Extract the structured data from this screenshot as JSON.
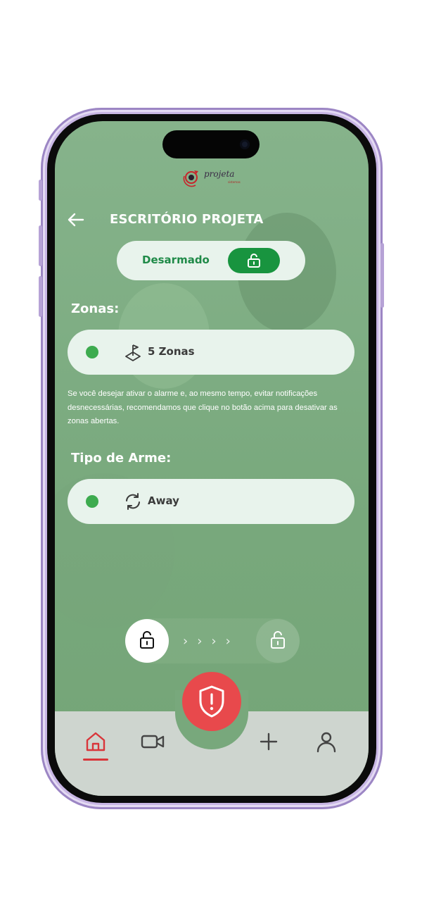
{
  "app": {
    "logo_text": "projeta",
    "logo_sub": "sistemas"
  },
  "header": {
    "title": "ESCRITÓRIO PROJETA",
    "back_icon": "arrow-left-icon"
  },
  "status": {
    "label": "Desarmado",
    "toggle_icon": "unlock-icon",
    "toggle_color": "#18943f"
  },
  "zones": {
    "title": "Zonas:",
    "card": {
      "status_color": "#3dab4f",
      "icon": "map-flag-icon",
      "label": "5 Zonas"
    }
  },
  "info_text": "Se você desejar ativar o alarme e, ao mesmo tempo, evitar notificações desnecessárias, recomendamos que clique no botão acima para desativar as zonas abertas.",
  "arm_type": {
    "title": "Tipo de Arme:",
    "card": {
      "status_color": "#3dab4f",
      "icon": "refresh-icon",
      "label": "Away"
    }
  },
  "slider": {
    "knob_icon": "unlock-icon",
    "chevrons": "›››› ",
    "target_icon": "unlock-icon"
  },
  "panic_button": {
    "icon": "shield-alert-icon",
    "color": "#e8494c"
  },
  "navbar": {
    "items": [
      {
        "icon": "home-icon",
        "active": true
      },
      {
        "icon": "video-camera-icon",
        "active": false
      },
      {
        "icon": "plus-icon",
        "active": false
      },
      {
        "icon": "user-icon",
        "active": false
      }
    ],
    "active_color": "#d9353a"
  }
}
